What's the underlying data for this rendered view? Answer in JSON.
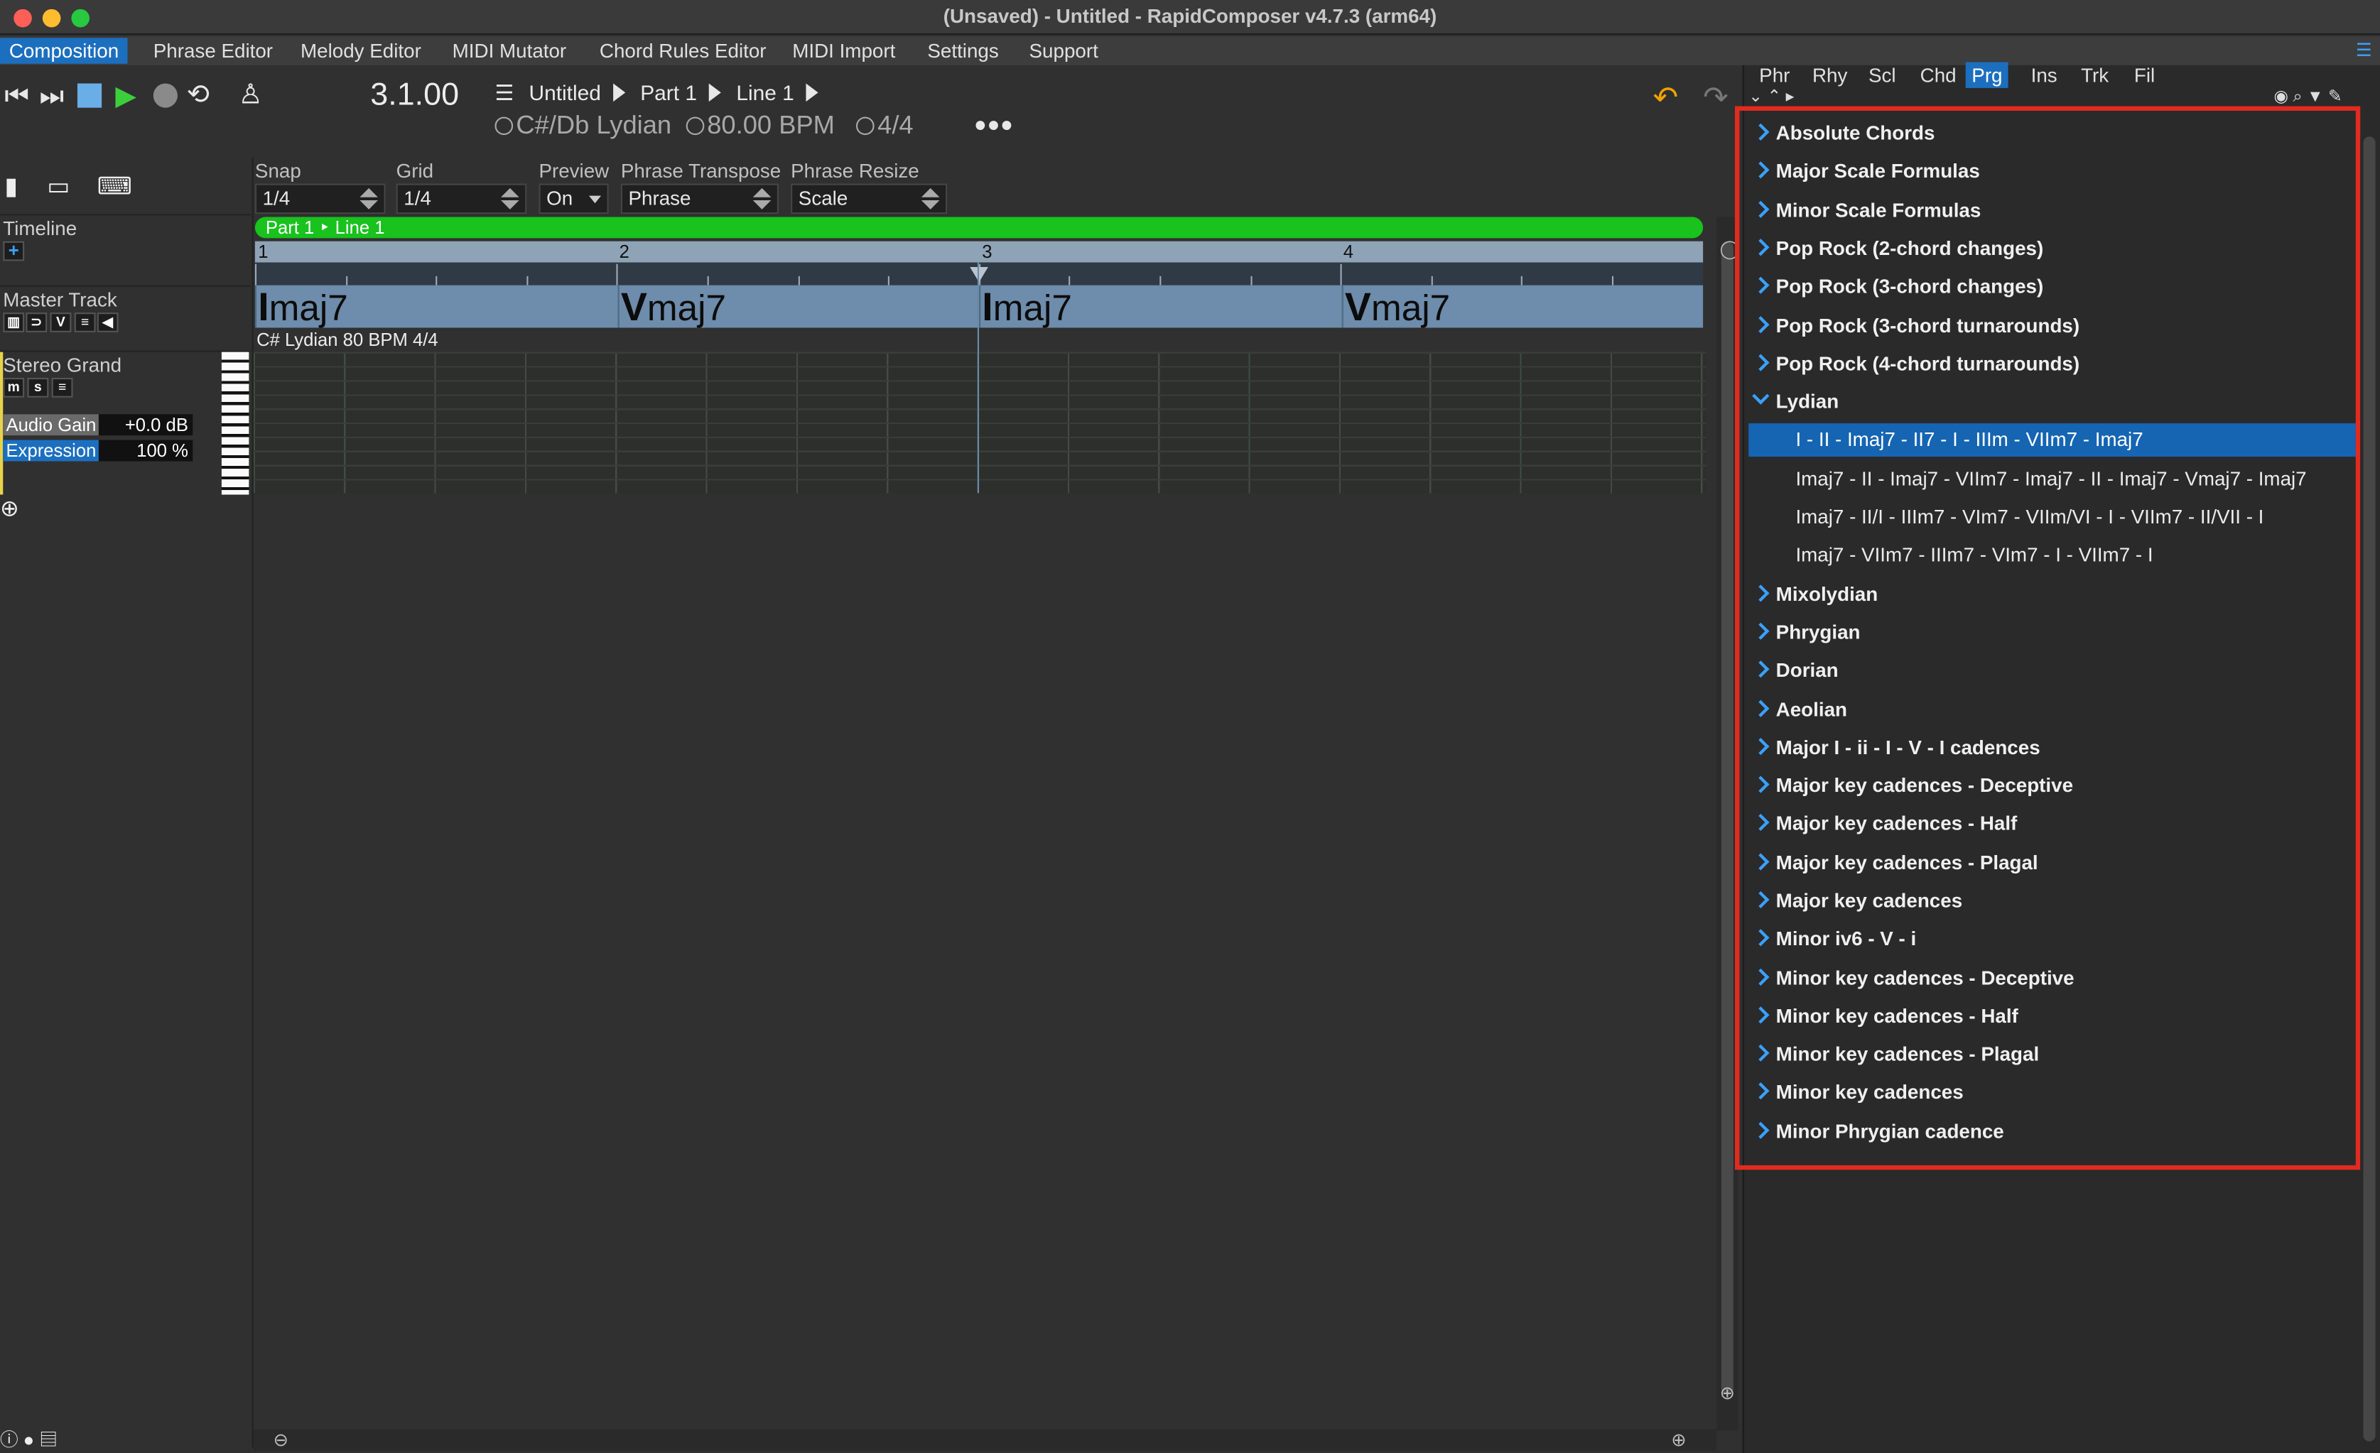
{
  "window": {
    "title": "(Unsaved) - Untitled - RapidComposer v4.7.3 (arm64)"
  },
  "menu": [
    {
      "label": "Composition",
      "active": true
    },
    {
      "label": "Phrase Editor"
    },
    {
      "label": "Melody Editor"
    },
    {
      "label": "MIDI Mutator"
    },
    {
      "label": "Chord Rules Editor"
    },
    {
      "label": "MIDI Import"
    },
    {
      "label": "Settings"
    },
    {
      "label": "Support"
    }
  ],
  "transport": {
    "position": "3.1.00",
    "breadcrumb": [
      "Untitled",
      "Part 1",
      "Line 1"
    ],
    "key": "C#/Db Lydian",
    "tempo": "80.00 BPM",
    "meter": "4/4",
    "more": "•••",
    "icons": [
      "skip-back-icon",
      "skip-forward-icon",
      "stop-icon",
      "play-icon",
      "record-icon",
      "loop-icon",
      "metronome-icon",
      "undo-icon",
      "redo-icon"
    ]
  },
  "controls": {
    "snap": {
      "label": "Snap",
      "value": "1/4"
    },
    "grid": {
      "label": "Grid",
      "value": "1/4"
    },
    "preview": {
      "label": "Preview",
      "value": "On"
    },
    "phrase_transpose": {
      "label": "Phrase Transpose",
      "value": "Phrase"
    },
    "phrase_resize": {
      "label": "Phrase Resize",
      "value": "Scale"
    }
  },
  "left": {
    "timeline_label": "Timeline",
    "master_track_label": "Master Track",
    "instrument_label": "Stereo Grand",
    "mute_btn": "m",
    "solo_btn": "s",
    "audio_gain": {
      "label": "Audio Gain",
      "value": "+0.0 dB",
      "fraction": 0.5
    },
    "expression": {
      "label": "Expression",
      "value": "100 %",
      "fraction": 0.5
    }
  },
  "timeline": {
    "part_bar": "Part 1 ‣ Line 1",
    "bars": [
      "1",
      "2",
      "3",
      "4"
    ],
    "chords": [
      {
        "degree": "I",
        "quality": "maj7"
      },
      {
        "degree": "V",
        "quality": "maj7"
      },
      {
        "degree": "I",
        "quality": "maj7"
      },
      {
        "degree": "V",
        "quality": "maj7"
      }
    ],
    "caption": "C# Lydian 80 BPM 4/4"
  },
  "right": {
    "tabs": [
      {
        "label": "Phr"
      },
      {
        "label": "Rhy"
      },
      {
        "label": "Scl"
      },
      {
        "label": "Chd"
      },
      {
        "label": "Prg",
        "active": true
      },
      {
        "label": "Ins"
      },
      {
        "label": "Trk"
      },
      {
        "label": "Fil"
      }
    ],
    "tree_before": [
      "Absolute Chords",
      "Major Scale Formulas",
      "Minor Scale Formulas",
      "Pop Rock (2-chord changes)",
      "Pop Rock (3-chord changes)",
      "Pop Rock (3-chord turnarounds)",
      "Pop Rock (4-chord turnarounds)"
    ],
    "expanded": "Lydian",
    "leaves": [
      {
        "label": "I - II - Imaj7 - II7 - I - IIIm - VIIm7 - Imaj7",
        "selected": true
      },
      {
        "label": "Imaj7 - II - Imaj7 - VIIm7 - Imaj7 - II - Imaj7 - Vmaj7 - Imaj7"
      },
      {
        "label": "Imaj7 - II/I - IIIm7 - VIm7 - VIIm/VI - I - VIIm7 - II/VII - I"
      },
      {
        "label": "Imaj7 - VIIm7 - IIIm7 - VIm7 - I - VIIm7 - I"
      }
    ],
    "tree_after": [
      "Mixolydian",
      "Phrygian",
      "Dorian",
      "Aeolian",
      "Major I - ii - I - V - I cadences",
      "Major key cadences - Deceptive",
      "Major key cadences - Half",
      "Major key cadences - Plagal",
      "Major key cadences",
      "Minor iv6 - V - i",
      "Minor key cadences - Deceptive",
      "Minor key cadences - Half",
      "Minor key cadences - Plagal",
      "Minor key cadences",
      "Minor Phrygian cadence"
    ],
    "highlight_color": "#e02b20",
    "selection_color": "#1565b3"
  }
}
